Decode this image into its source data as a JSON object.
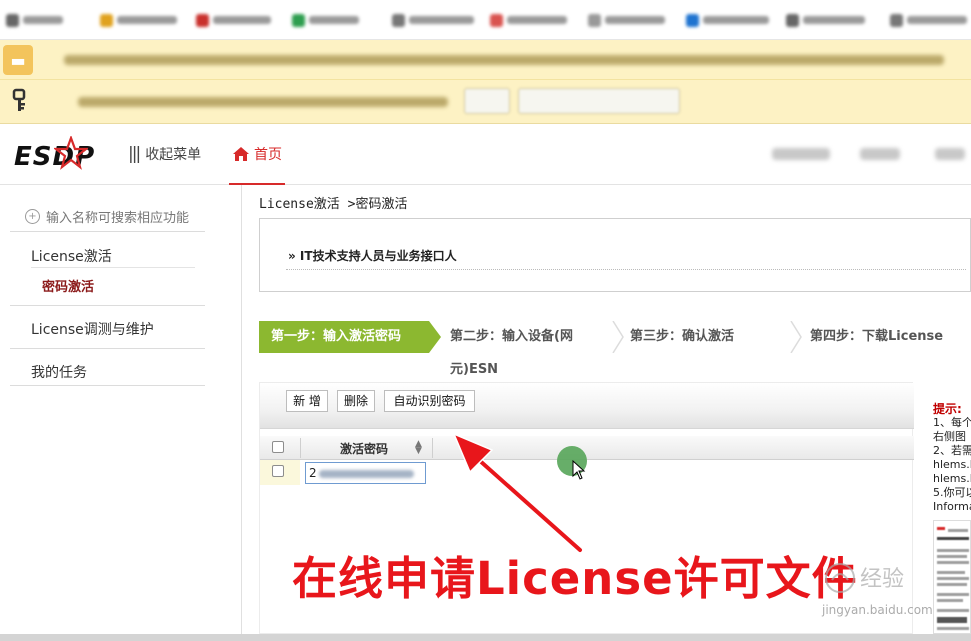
{
  "app": {
    "logo": "ESDP",
    "collapse_label": "收起菜单",
    "home_label": "首页"
  },
  "sidebar": {
    "search_placeholder": "输入名称可搜索相应功能",
    "items": [
      {
        "label": "License激活",
        "children": [
          {
            "label": "密码激活",
            "selected": true
          }
        ]
      },
      {
        "label": "License调测与维护"
      },
      {
        "label": "我的任务"
      }
    ]
  },
  "breadcrumb": "License激活 >密码激活",
  "info_section": "» IT技术支持人员与业务接口人",
  "steps": [
    {
      "label": "第一步：输入激活密码",
      "active": true
    },
    {
      "label": "第二步：输入设备(网",
      "label_line2": "元)ESN",
      "active": false
    },
    {
      "label": "第三步：确认激活",
      "active": false
    },
    {
      "label": "第四步：下载License",
      "active": false
    }
  ],
  "toolbar": {
    "add_label": "新 增",
    "delete_label": "删除",
    "auto_recognize_label": "自动识别密码"
  },
  "grid": {
    "column_header": "激活密码",
    "rows": [
      {
        "value_prefix": "2"
      }
    ]
  },
  "hint": {
    "title": "提示:",
    "lines": [
      "1、每个",
      "右侧图",
      "2、若需",
      "hlems.l",
      "hlems.l",
      "5.你可以",
      "Informa"
    ]
  },
  "annotation": "在线申请License许可文件",
  "colors": {
    "accent_red": "#d72a2a",
    "step_active": "#8cb830",
    "annotation_red": "#e8161b",
    "notice_bg": "#fdf2c4"
  }
}
